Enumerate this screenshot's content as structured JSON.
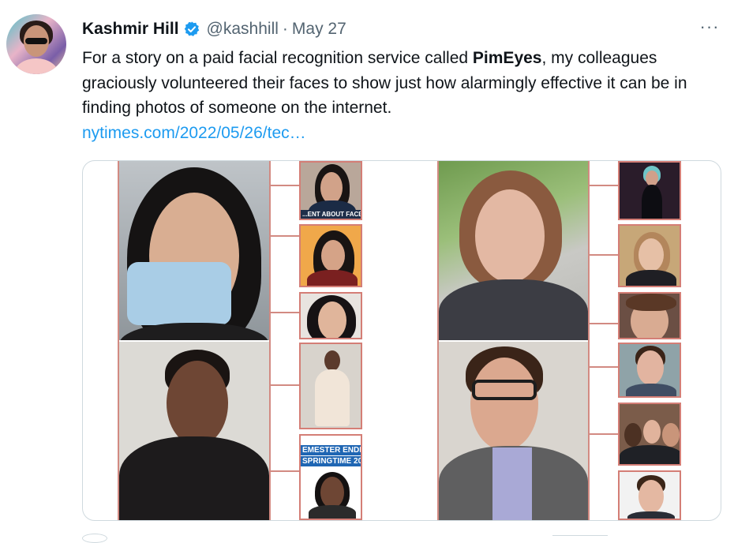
{
  "author": {
    "name": "Kashmir Hill",
    "handle": "@kashhill",
    "separator": "·",
    "date": "May 27",
    "verified": true
  },
  "more_icon": "more-horizontal-icon",
  "tweet": {
    "text_before": "For a story on a paid facial recognition service called ",
    "bold": "PimEyes",
    "text_after": ", my colleagues graciously volunteered their faces to show just how alarmingly effective it can be in finding photos of someone on the internet.",
    "link": "nytimes.com/2022/05/26/tec…"
  },
  "media": {
    "thumb_texts": {
      "t1_caption": "...ENT ABOUT FACEBOOK",
      "t8_line1": "EMESTER ENDI",
      "t8_line2": "SPRINGTIME 20"
    }
  },
  "colors": {
    "link": "#1d9bf0",
    "verified": "#1d9bf0",
    "secondary_text": "#536471",
    "connector": "#d28a82",
    "thumb_border": "#d47e76"
  }
}
